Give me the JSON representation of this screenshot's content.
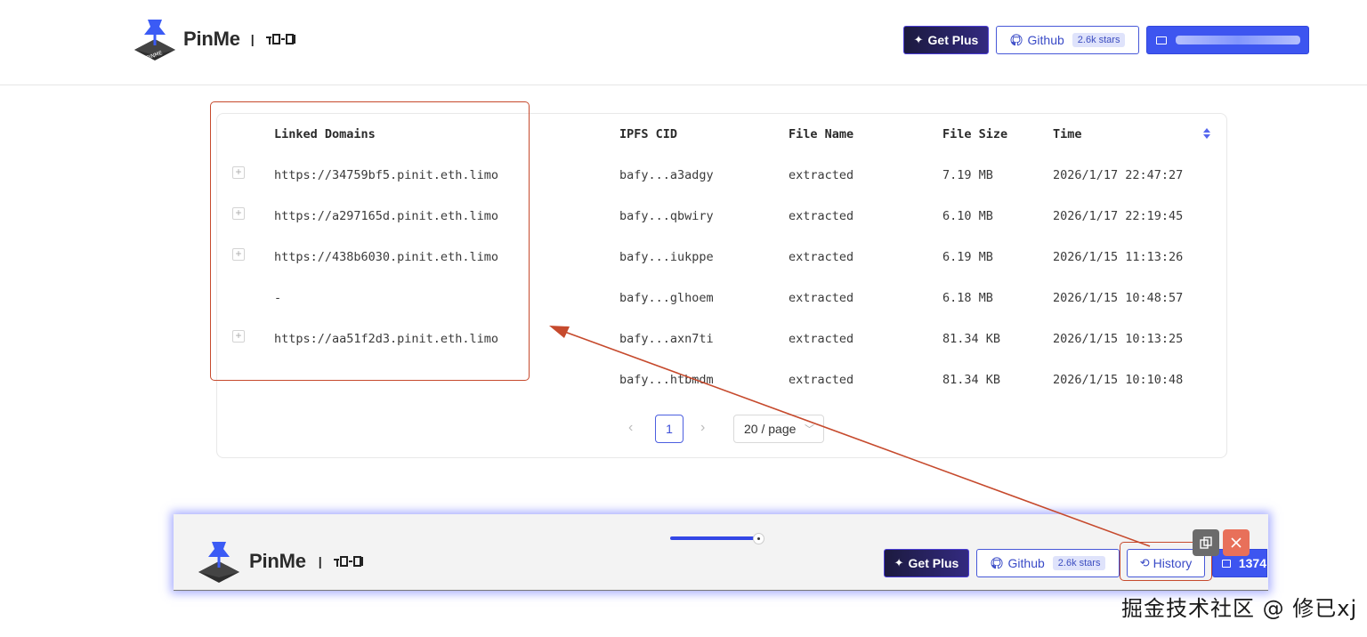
{
  "header": {
    "brand": "PinMe",
    "get_plus": "Get Plus",
    "github": "Github",
    "stars": "2.6k stars"
  },
  "table": {
    "columns": [
      "Linked Domains",
      "IPFS CID",
      "File Name",
      "File Size",
      "Time"
    ],
    "rows": [
      {
        "domain": "https://34759bf5.pinit.eth.limo",
        "cid": "bafy...a3adgy",
        "name": "extracted",
        "size": "7.19 MB",
        "time": "2026/1/17 22:47:27"
      },
      {
        "domain": "https://a297165d.pinit.eth.limo",
        "cid": "bafy...qbwiry",
        "name": "extracted",
        "size": "6.10 MB",
        "time": "2026/1/17 22:19:45"
      },
      {
        "domain": "https://438b6030.pinit.eth.limo",
        "cid": "bafy...iukppe",
        "name": "extracted",
        "size": "6.19 MB",
        "time": "2026/1/15 11:13:26"
      },
      {
        "domain": "-",
        "cid": "bafy...glhoem",
        "name": "extracted",
        "size": "6.18 MB",
        "time": "2026/1/15 10:48:57"
      },
      {
        "domain": "https://aa51f2d3.pinit.eth.limo",
        "cid": "bafy...axn7ti",
        "name": "extracted",
        "size": "81.34 KB",
        "time": "2026/1/15 10:13:25"
      },
      {
        "domain": "",
        "cid": "bafy...htbmdm",
        "name": "extracted",
        "size": "81.34 KB",
        "time": "2026/1/15 10:10:48"
      }
    ]
  },
  "pagination": {
    "current_page": "1",
    "page_size": "20 / page"
  },
  "embedded_header": {
    "brand": "PinMe",
    "get_plus": "Get Plus",
    "github": "Github",
    "stars": "2.6k stars",
    "history": "History",
    "user_partial": "1374"
  },
  "watermark": "掘金技术社区 @ 修已xj",
  "colors": {
    "accent": "#3d55f0",
    "annotation": "#c64a2d"
  }
}
